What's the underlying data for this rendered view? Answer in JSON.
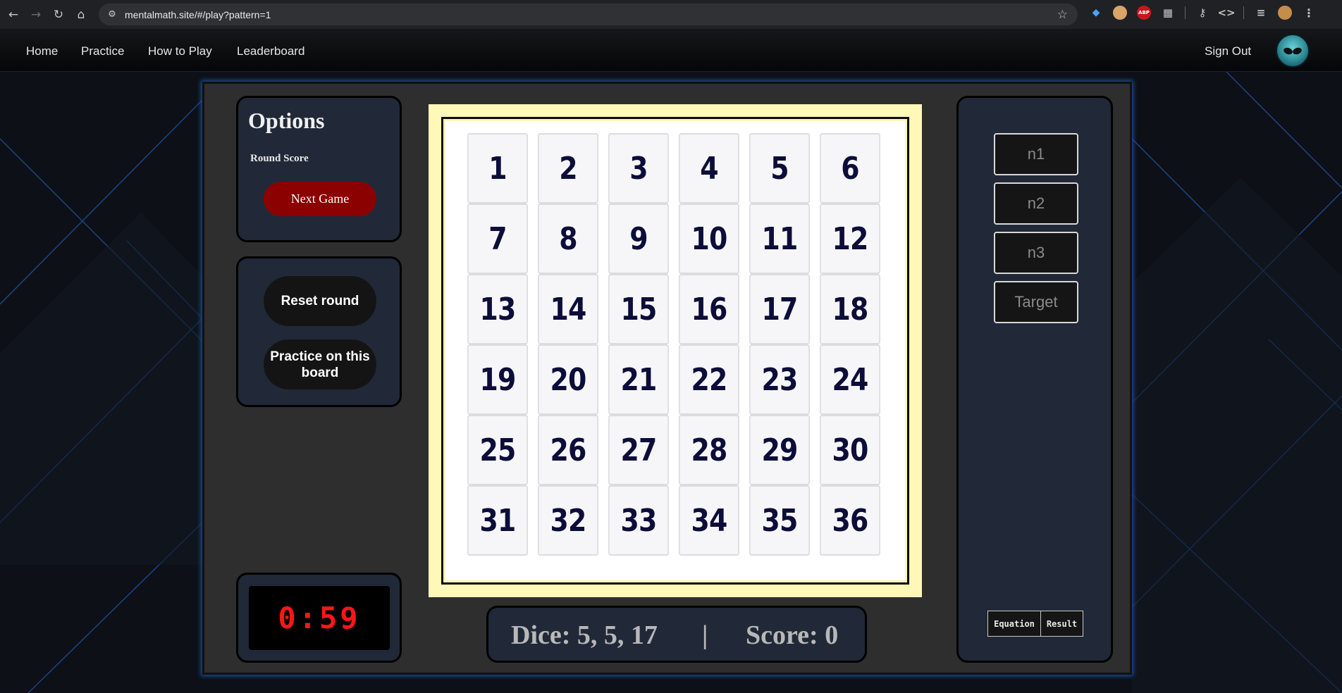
{
  "browser": {
    "url": "mentalmath.site/#/play?pattern=1",
    "back_icon": "back-arrow-icon",
    "forward_icon": "forward-arrow-icon",
    "reload_icon": "reload-icon",
    "home_icon": "home-icon"
  },
  "nav": {
    "items": [
      "Home",
      "Practice",
      "How to Play",
      "Leaderboard"
    ],
    "sign_out": "Sign Out"
  },
  "options": {
    "title": "Options",
    "round_score_label": "Round Score",
    "next_game": "Next Game"
  },
  "controls": {
    "reset_round": "Reset round",
    "practice_board": "Practice on this board"
  },
  "timer": "0:59",
  "board": {
    "numbers": [
      "1",
      "2",
      "3",
      "4",
      "5",
      "6",
      "7",
      "8",
      "9",
      "10",
      "11",
      "12",
      "13",
      "14",
      "15",
      "16",
      "17",
      "18",
      "19",
      "20",
      "21",
      "22",
      "23",
      "24",
      "25",
      "26",
      "27",
      "28",
      "29",
      "30",
      "31",
      "32",
      "33",
      "34",
      "35",
      "36"
    ]
  },
  "status": {
    "dice": "Dice: 5, 5, 17",
    "separator": "|",
    "score": "Score: 0"
  },
  "inputs": {
    "n1": "n1",
    "n2": "n2",
    "n3": "n3",
    "target": "Target"
  },
  "tabs": {
    "equation": "Equation",
    "result": "Result"
  },
  "colors": {
    "next_game_bg": "#8b0000",
    "timer_digits": "#ff1616",
    "board_bg": "#fff8b8",
    "cell_number": "#0d0d3a",
    "panel_bg": "#212938",
    "frame_glow": "#1b4f9b"
  }
}
